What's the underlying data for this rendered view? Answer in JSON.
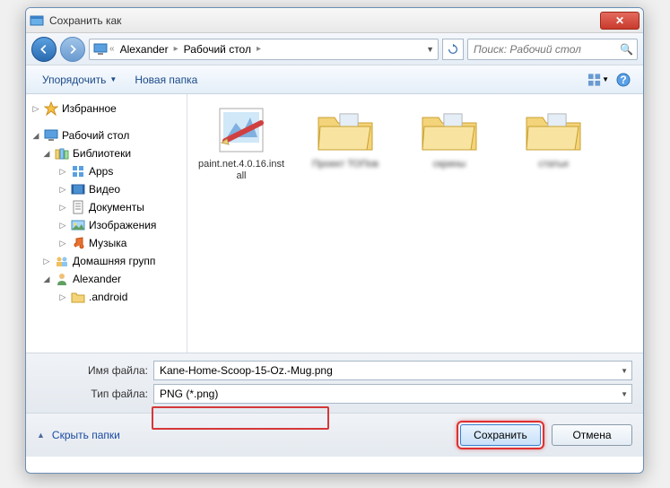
{
  "window": {
    "title": "Сохранить как",
    "close_glyph": "✕"
  },
  "nav": {
    "breadcrumb": [
      "Alexander",
      "Рабочий стол"
    ],
    "search_placeholder": "Поиск: Рабочий стол"
  },
  "toolbar": {
    "organize": "Упорядочить",
    "new_folder": "Новая папка"
  },
  "tree": [
    {
      "level": 0,
      "icon": "star",
      "label": "Избранное",
      "exp": "▷"
    },
    {
      "level": 0,
      "icon": "desktop",
      "label": "Рабочий стол",
      "exp": "◢"
    },
    {
      "level": 1,
      "icon": "libraries",
      "label": "Библиотеки",
      "exp": "◢"
    },
    {
      "level": 2,
      "icon": "apps",
      "label": "Apps",
      "exp": "▷"
    },
    {
      "level": 2,
      "icon": "video",
      "label": "Видео",
      "exp": "▷"
    },
    {
      "level": 2,
      "icon": "docs",
      "label": "Документы",
      "exp": "▷"
    },
    {
      "level": 2,
      "icon": "images",
      "label": "Изображения",
      "exp": "▷"
    },
    {
      "level": 2,
      "icon": "music",
      "label": "Музыка",
      "exp": "▷"
    },
    {
      "level": 1,
      "icon": "homegroup",
      "label": "Домашняя групп",
      "exp": "▷"
    },
    {
      "level": 1,
      "icon": "user",
      "label": "Alexander",
      "exp": "◢"
    },
    {
      "level": 2,
      "icon": "folder",
      "label": ".android",
      "exp": "▷"
    }
  ],
  "files": [
    {
      "type": "app",
      "name": "paint.net.4.0.16.install",
      "blur": false
    },
    {
      "type": "folder",
      "name": "Проект ТОПов",
      "blur": true
    },
    {
      "type": "folder",
      "name": "скрины",
      "blur": true
    },
    {
      "type": "folder",
      "name": "статьи",
      "blur": true
    }
  ],
  "meta": {
    "filename_label": "Имя файла:",
    "filename_value": "Kane-Home-Scoop-15-Oz.-Mug.png",
    "filetype_label": "Тип файла:",
    "filetype_value": "PNG (*.png)"
  },
  "footer": {
    "hide_folders": "Скрыть папки",
    "save": "Сохранить",
    "cancel": "Отмена"
  },
  "icons": {
    "star_color": "#f6c046",
    "folder_fill": "#f4d47a",
    "folder_stroke": "#c8a030"
  }
}
